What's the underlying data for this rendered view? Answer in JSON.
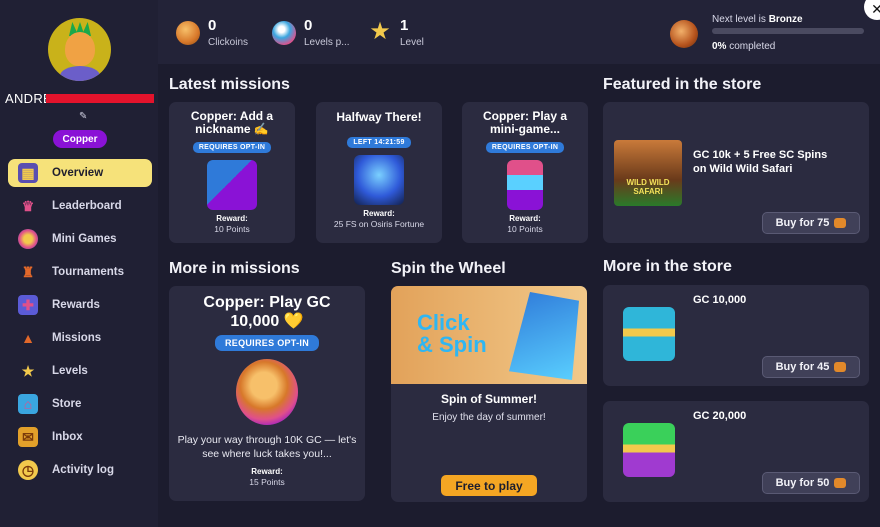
{
  "user": {
    "name": "ANDREEBALDUCCI",
    "tier": "Copper"
  },
  "nav": [
    {
      "label": "Overview",
      "icon": "overview-icon",
      "active": true
    },
    {
      "label": "Leaderboard",
      "icon": "leaderboard-icon"
    },
    {
      "label": "Mini Games",
      "icon": "mini-games-icon"
    },
    {
      "label": "Tournaments",
      "icon": "tournaments-icon"
    },
    {
      "label": "Rewards",
      "icon": "rewards-icon"
    },
    {
      "label": "Missions",
      "icon": "missions-icon"
    },
    {
      "label": "Levels",
      "icon": "levels-icon"
    },
    {
      "label": "Store",
      "icon": "store-icon"
    },
    {
      "label": "Inbox",
      "icon": "inbox-icon"
    },
    {
      "label": "Activity log",
      "icon": "activity-log-icon"
    }
  ],
  "stats": [
    {
      "value": "0",
      "label": "Clickoins",
      "icon": "clickoins-icon"
    },
    {
      "value": "0",
      "label": "Levels p...",
      "icon": "levels-passed-icon"
    },
    {
      "value": "1",
      "label": "Level",
      "icon": "level-star-icon"
    }
  ],
  "level_progress": {
    "next_prefix": "Next level is ",
    "next_level": "Bronze",
    "percent": "0%",
    "completed_label": " completed",
    "fraction": 0
  },
  "sections": {
    "latest_missions": "Latest missions",
    "featured_store": "Featured in the store",
    "more_missions": "More in missions",
    "spin_wheel": "Spin the Wheel",
    "more_store": "More in the store"
  },
  "latest_missions": [
    {
      "title": "Copper: Add a nickname ✍",
      "badge": "REQUIRES OPT-IN",
      "reward_label": "Reward:",
      "reward": "10 Points"
    },
    {
      "title": "Halfway There!",
      "badge": "LEFT 14:21:59",
      "reward_label": "Reward:",
      "reward": "25 FS on Osiris Fortune"
    },
    {
      "title": "Copper: Play a mini-game...",
      "badge": "REQUIRES OPT-IN",
      "reward_label": "Reward:",
      "reward": "10 Points"
    }
  ],
  "featured_store": {
    "title": "GC 10k + 5 Free SC Spins on Wild Wild Safari",
    "button": "Buy for 75",
    "art_text": "WILD WILD SAFARI"
  },
  "more_mission": {
    "title": "Copper: Play GC 10,000 💛",
    "badge": "REQUIRES OPT-IN",
    "description": "Play your way through 10K GC — let's see where luck takes you!...",
    "reward_label": "Reward:",
    "reward": "15 Points"
  },
  "spin": {
    "art_text_1": "Click",
    "art_text_2": "& Spin",
    "title": "Spin of Summer!",
    "subtitle": "Enjoy the day of summer!",
    "button": "Free to play"
  },
  "more_store": [
    {
      "title": "GC 10,000",
      "button": "Buy for 45"
    },
    {
      "title": "GC 20,000",
      "button": "Buy for 50"
    }
  ],
  "colors": {
    "accent_yellow": "#f6e27a",
    "tier_purple": "#8a12d6",
    "pill_blue": "#2f7ad9",
    "spin_button": "#f5a623",
    "card_bg": "#2b2b40",
    "page_bg": "#1c1c2e"
  }
}
